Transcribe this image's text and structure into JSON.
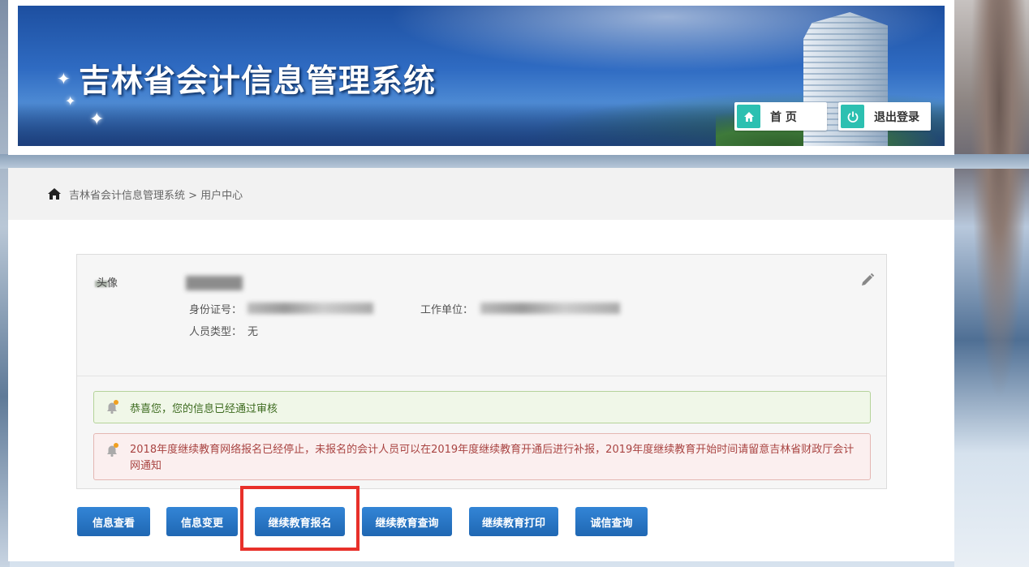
{
  "header": {
    "title": "吉林省会计信息管理系统",
    "nav": {
      "home_label": "首 页",
      "logout_label": "退出登录"
    }
  },
  "breadcrumb": {
    "text": "吉林省会计信息管理系统 > 用户中心"
  },
  "profile": {
    "avatar_label": "头像",
    "id_label": "身份证号：",
    "work_unit_label": "工作单位：",
    "person_type_label": "人员类型：",
    "person_type_value": "无"
  },
  "alerts": {
    "success_text": "恭喜您，您的信息已经通过审核",
    "warning_text": "2018年度继续教育网络报名已经停止，未报名的会计人员可以在2019年度继续教育开通后进行补报，2019年度继续教育开始时间请留意吉林省财政厅会计网通知"
  },
  "actions": [
    {
      "label": "信息查看"
    },
    {
      "label": "信息变更"
    },
    {
      "label": "继续教育报名"
    },
    {
      "label": "继续教育查询"
    },
    {
      "label": "继续教育打印"
    },
    {
      "label": "诚信查询"
    }
  ],
  "colors": {
    "button_blue": "#2a75c4",
    "icon_teal": "#2cc0b1",
    "highlight_red": "#e8302a"
  }
}
